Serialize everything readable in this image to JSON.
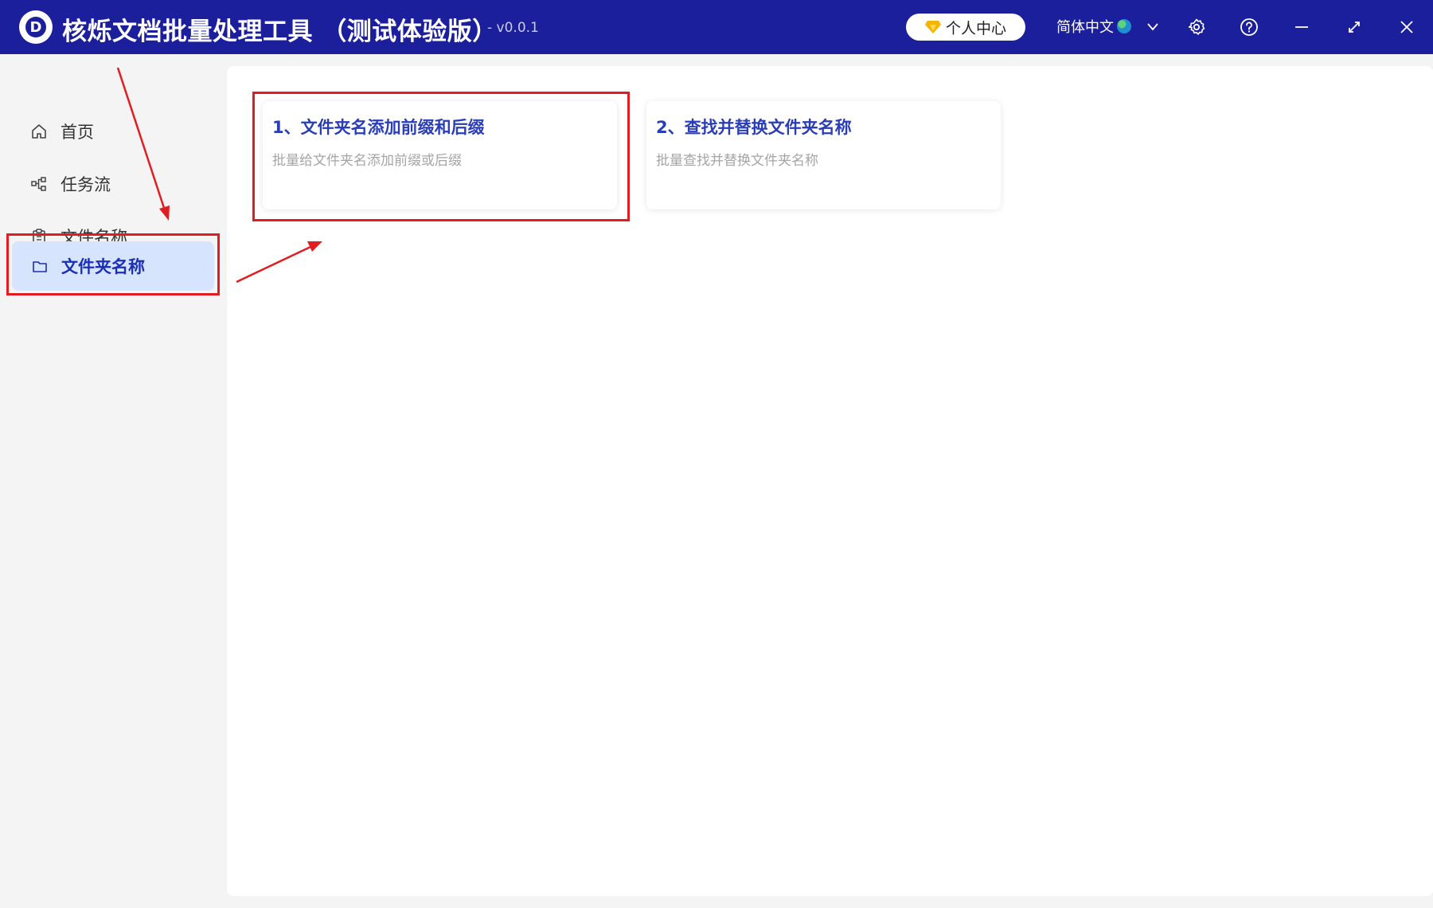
{
  "titlebar": {
    "logo_letter": "D",
    "app_title": "核烁文档批量处理工具 （测试体验版）",
    "version": "- v0.0.1",
    "user_center_label": "个人中心",
    "language_label": "简体中文",
    "icons": [
      "gem-icon",
      "globe-icon",
      "chevron-down-icon",
      "gear-icon",
      "help-icon",
      "minimize-icon",
      "maximize-icon",
      "close-icon"
    ],
    "accent_color": "#1b1f9c"
  },
  "sidebar": {
    "items": [
      {
        "label": "首页",
        "icon": "home-icon",
        "active": false
      },
      {
        "label": "任务流",
        "icon": "workflow-icon",
        "active": false
      },
      {
        "label": "文件名称",
        "icon": "file-icon",
        "active": false
      },
      {
        "label": "文件夹名称",
        "icon": "folder-icon",
        "active": true
      }
    ],
    "active_bg": "#d6e4fd",
    "active_color": "#1b2fb5"
  },
  "main": {
    "cards": [
      {
        "title": "1、文件夹名添加前缀和后缀",
        "description": "批量给文件夹名添加前缀或后缀"
      },
      {
        "title": "2、查找并替换文件夹名称",
        "description": "批量查找并替换文件夹名称"
      }
    ]
  },
  "annotations": {
    "highlight_color": "#e11d22"
  }
}
